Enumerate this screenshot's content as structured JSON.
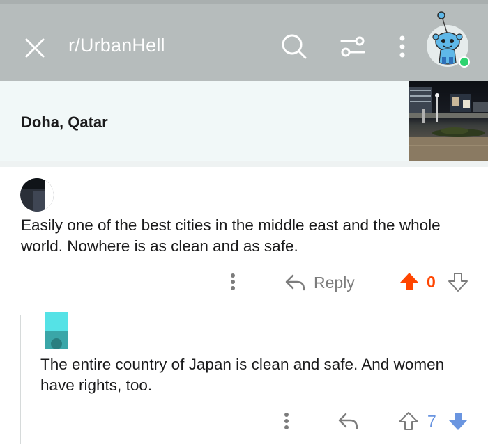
{
  "header": {
    "subreddit": "r/UrbanHell"
  },
  "post": {
    "title": "Doha, Qatar"
  },
  "comments": [
    {
      "text": "Easily one of the best cities in the middle east and the whole world. Nowhere is as clean and as safe.",
      "reply_label": "Reply",
      "score": "0",
      "vote_state": "upvoted",
      "vote_color": "#ff4500"
    },
    {
      "text": "The entire country of Japan is clean and safe. And women have rights, too.",
      "score": "7",
      "vote_state": "downvoted",
      "vote_color": "#6a95e0"
    }
  ],
  "icons": {
    "close": "close-icon",
    "search": "search-icon",
    "filter": "filter-icon",
    "more": "more-vertical-icon",
    "reply": "reply-arrow-icon",
    "upvote": "upvote-arrow-icon",
    "downvote": "downvote-arrow-icon"
  },
  "colors": {
    "header_bg": "#b6bcbc",
    "post_header_bg": "#f1f8f8",
    "upvote": "#ff4500",
    "downvote": "#6a95e0",
    "online": "#2dd36f"
  }
}
